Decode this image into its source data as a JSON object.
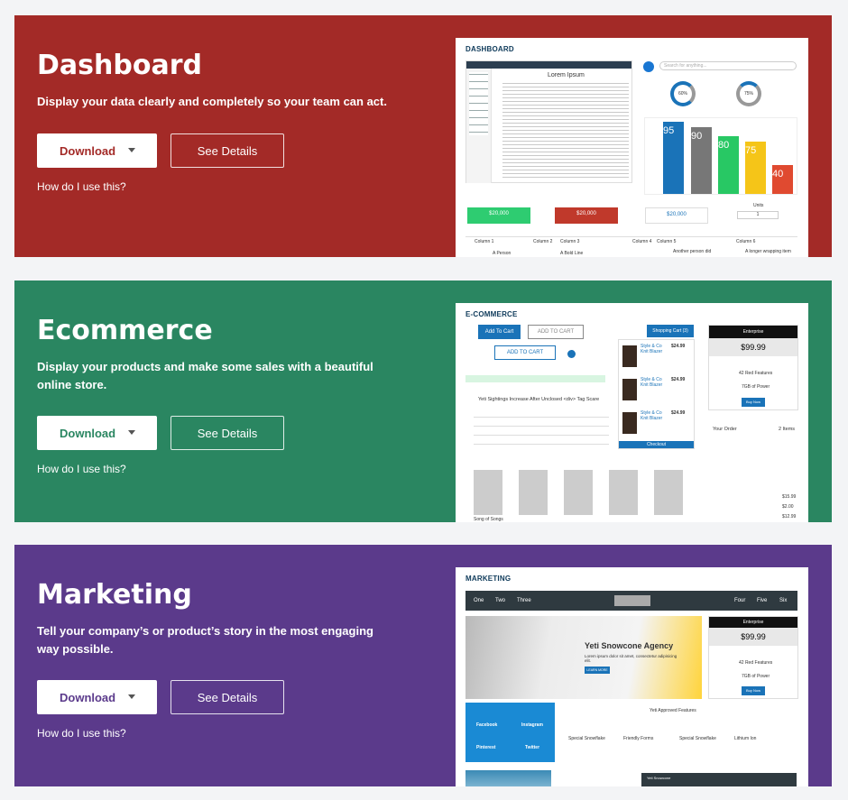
{
  "cards": [
    {
      "title": "Dashboard",
      "desc": "Display your data clearly and completely so your team can act.",
      "download": "Download",
      "details": "See Details",
      "howto": "How do I use this?",
      "color": "#a32a27",
      "shot": {
        "title": "DASHBOARD",
        "doc_title": "Lorem Ipsum",
        "search_placeholder": "Search for anything...",
        "progress": [
          "60%",
          "75%"
        ],
        "bars": [
          "95",
          "90",
          "80",
          "75",
          "40"
        ],
        "bar_labels": [
          "",
          "",
          "",
          "",
          ""
        ],
        "stats": [
          "$20,000",
          "$20,000",
          "$20,000"
        ],
        "units_label": "Units",
        "units_value": "1",
        "columns": [
          "Column 1",
          "Column 2",
          "Column 3",
          "Column 4",
          "Column 5",
          "Column 6"
        ],
        "rows": [
          "A Person",
          "A Bold Line",
          "Another person did",
          "A longer wrapping item"
        ]
      }
    },
    {
      "title": "Ecommerce",
      "desc": "Display your products and make some sales with a beautiful online store.",
      "download": "Download",
      "details": "See Details",
      "howto": "How do I use this?",
      "color": "#2a8661",
      "shot": {
        "title": "E-COMMERCE",
        "add_cart": "Add To Cart",
        "add_cart_outline": "ADD TO CART",
        "add_cart_icon": "ADD TO CART",
        "shopping_cart": "Shopping Cart (3)",
        "headline": "Yeti Sightings Increase After Unclosed <div> Tag Scare",
        "products": [
          {
            "name": "Style & Co Knit Blazer",
            "price": "$24.99",
            "color": "Blue",
            "size": "M"
          },
          {
            "name": "Style & Co Knit Blazer",
            "price": "$24.99",
            "color": "Blue",
            "size": "M"
          },
          {
            "name": "Style & Co Knit Blazer",
            "price": "$24.99",
            "color": "Blue",
            "size": "M"
          }
        ],
        "checkout": "Checkout",
        "plan": "Enterprise",
        "plan_price": "$99.99",
        "plan_features": [
          "42 Red Features",
          "7GB of Power"
        ],
        "buy": "Buy Now",
        "order_title": "Your Order",
        "order_count": "2 Items",
        "subtotal": "$15.99",
        "tax": "$2.00",
        "total": "$12.99",
        "song": "Song of Songs"
      }
    },
    {
      "title": "Marketing",
      "desc": "Tell your company’s or product’s story in the most engaging way possible.",
      "download": "Download",
      "details": "See Details",
      "howto": "How do I use this?",
      "color": "#5b3a8b",
      "shot": {
        "title": "MARKETING",
        "nav": [
          "One",
          "Two",
          "Three",
          "Four",
          "Five",
          "Six"
        ],
        "hero": "Yeti Snowcone Agency",
        "hero_sub": "Lorem ipsum dolor sit amet, consectetur adipisicing elit.",
        "learn": "LEARN MORE",
        "plan": "Enterprise",
        "plan_price": "$99.99",
        "plan_features": [
          "42 Red Features",
          "7GB of Power"
        ],
        "buy": "Buy Now",
        "social": [
          "Facebook",
          "Instagram",
          "Pinterest",
          "Twitter"
        ],
        "features_title": "Yeti Approved Features",
        "features": [
          "Special Snowflake",
          "Friendly Forms",
          "Special Snowflake",
          "Lithium Ion"
        ],
        "footer_brand": "Yeti Snowcone"
      }
    }
  ]
}
